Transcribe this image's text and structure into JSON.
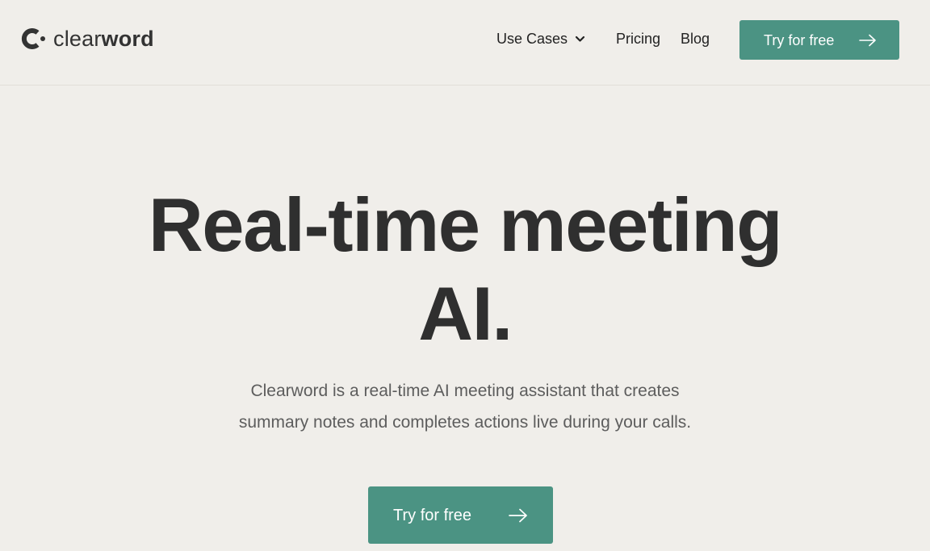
{
  "brand": {
    "name_light": "clear",
    "name_bold": "word",
    "accent_color": "#4b9383"
  },
  "nav": {
    "use_cases_label": "Use Cases",
    "pricing_label": "Pricing",
    "blog_label": "Blog"
  },
  "header_cta": {
    "label": "Try for free",
    "icon": "arrow-right-icon"
  },
  "hero": {
    "title_line1": "Real-time meeting",
    "title_line2": "AI.",
    "subtitle_line1": "Clearword is a real-time AI meeting assistant that creates",
    "subtitle_line2": "summary notes and completes actions live during your calls.",
    "cta_label": "Try for free",
    "cta_icon": "arrow-right-icon"
  }
}
